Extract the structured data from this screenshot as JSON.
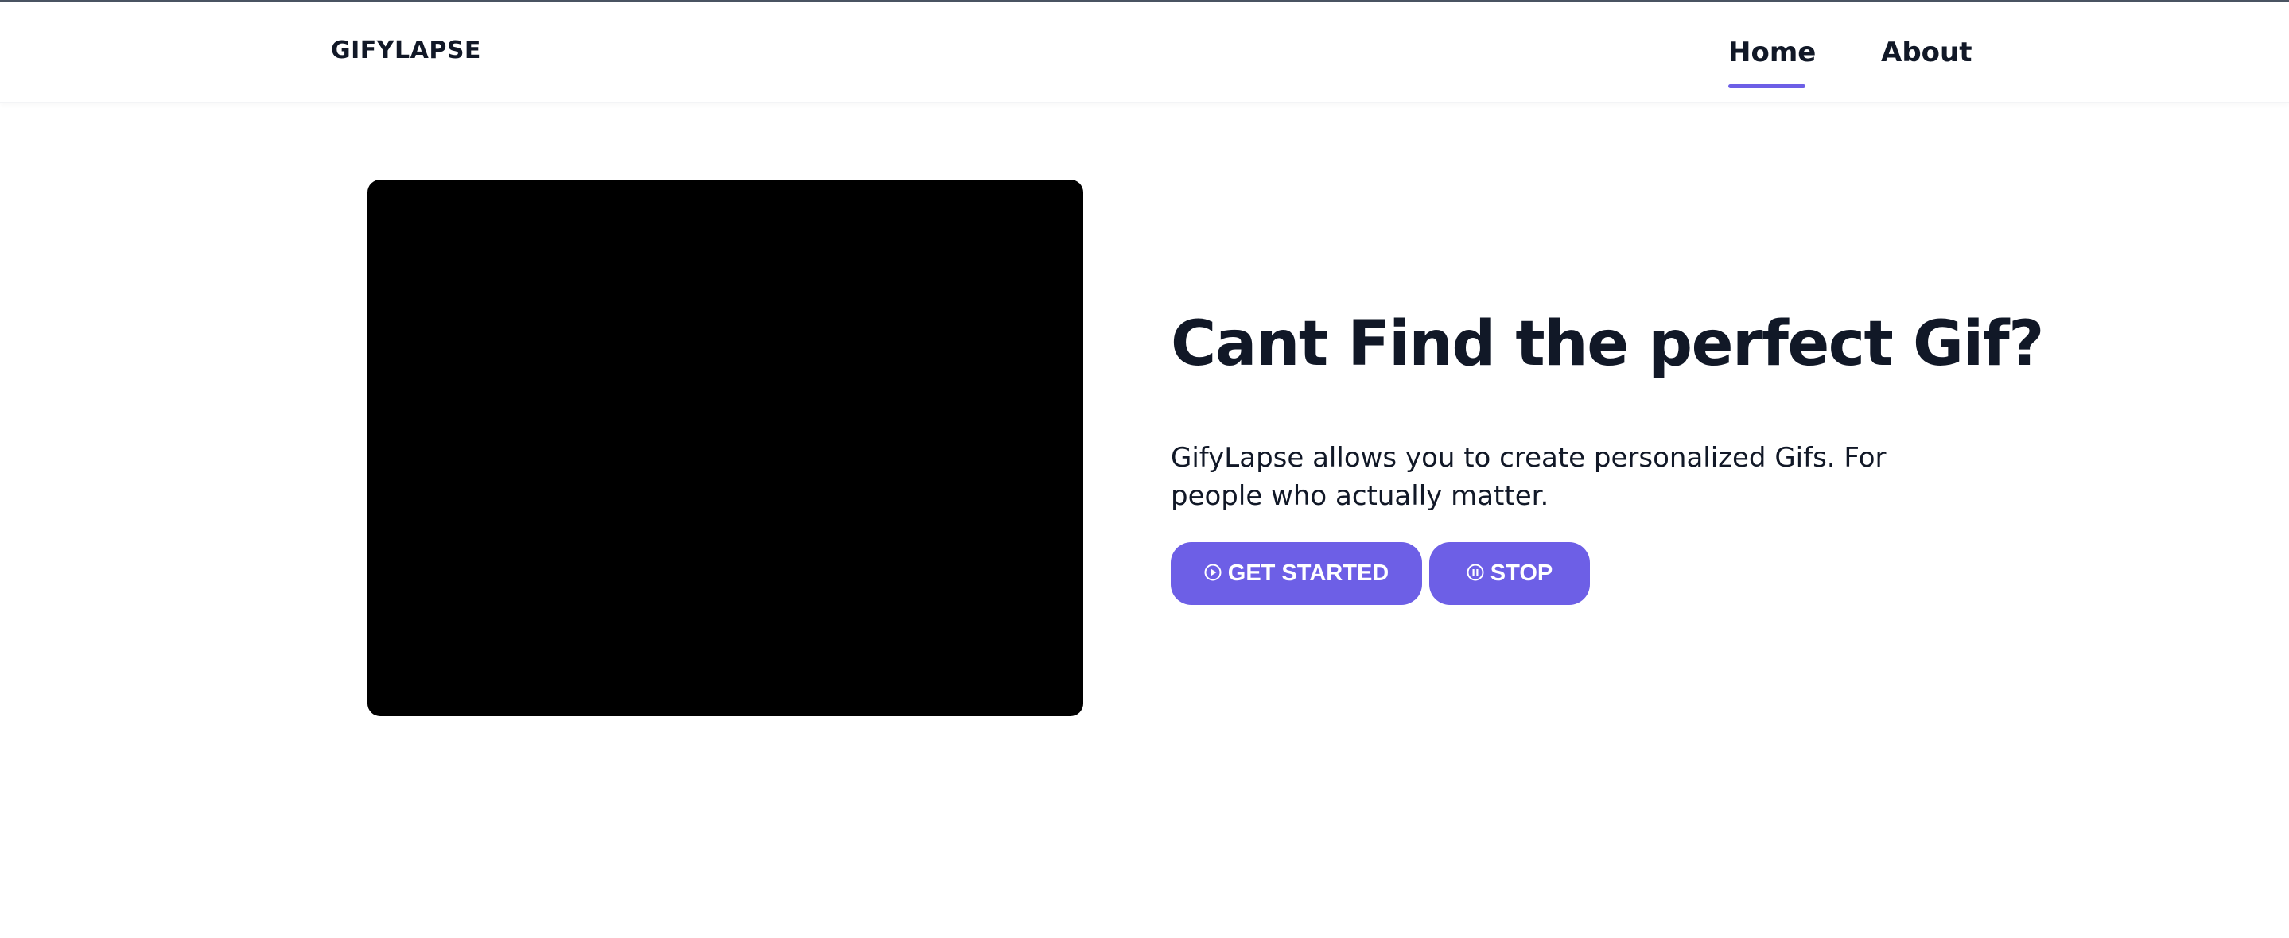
{
  "header": {
    "brand": "GIFYLAPSE",
    "nav": [
      {
        "label": "Home",
        "active": true
      },
      {
        "label": "About",
        "active": false
      }
    ]
  },
  "hero": {
    "headline": "Cant Find the perfect Gif?",
    "description": "GifyLapse allows you to create personalized Gifs. For people who actually matter.",
    "buttons": {
      "start": {
        "label": "GET STARTED",
        "icon": "play-circle-icon"
      },
      "stop": {
        "label": "STOP",
        "icon": "pause-circle-icon"
      }
    }
  },
  "colors": {
    "accent": "#6d5fe6",
    "text": "#111827",
    "video_bg": "#000000"
  }
}
